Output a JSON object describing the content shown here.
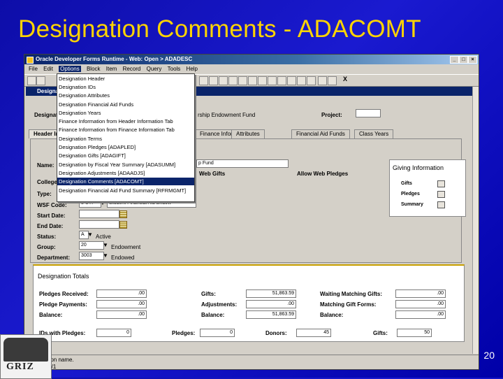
{
  "slide": {
    "title": "Designation Comments - ADACOMT",
    "page_number": "20",
    "logo_text": "GRIZ"
  },
  "window": {
    "title": "Oracle Developer Forms Runtime - Web: Open > ADADESC",
    "menubar": [
      "File",
      "Edit",
      "Options",
      "Block",
      "Item",
      "Record",
      "Query",
      "Tools",
      "Help"
    ],
    "active_menu": "Options",
    "toolbar_exit": "X"
  },
  "inner_window": {
    "title": "Designation"
  },
  "menu": {
    "items": [
      "Designation Header",
      "Designation IDs",
      "Designation Attributes",
      "Designation Financial Aid Funds",
      "Designation Years",
      "Finance Information from Header Information Tab",
      "Finance Information from Finance Information Tab",
      "Designation Terms",
      "Designation Pledges [ADAPLED]",
      "Designation Gifts [ADAGIFT]",
      "Designation by Fiscal Year Summary [ADASUMM]",
      "Designation Adjustments [ADAADJS]",
      "Designation Comments [ADACOMT]",
      "Designation Financial Aid Fund Summary [RFRMGMT]"
    ],
    "highlighted_index": 12
  },
  "header": {
    "designation_label": "Designation:",
    "designation_fragment": "rship Endowment Fund",
    "project_label": "Project:"
  },
  "tabs": [
    "Header Information",
    "Finance Information",
    "Attributes",
    "Financial Aid Funds",
    "Class Years"
  ],
  "form": {
    "name_label": "Name:",
    "name_value": "p Fund",
    "college_label": "College:",
    "type_label": "Type:",
    "wsf_label": "WSF Code:",
    "wsf_value": "8 UTI",
    "wsf_desc": "Student Financial Aid Endow",
    "start_label": "Start Date:",
    "end_label": "End Date:",
    "status_label": "Status:",
    "status_value": "A",
    "status_desc": "Active",
    "group_label": "Group:",
    "group_value": "20",
    "group_desc": "Endowment",
    "dept_label": "Department:",
    "dept_value": "3003",
    "dept_desc": "Endowed",
    "allow_web_gifts": "Web Gifts",
    "allow_web_pledges": "Allow Web Pledges"
  },
  "giving_information": {
    "title": "Giving Information",
    "items": [
      "Gifts",
      "Pledges",
      "Summary"
    ]
  },
  "totals": {
    "title": "Designation Totals",
    "left": [
      {
        "label": "Pledges Received:",
        "value": ".00"
      },
      {
        "label": "Pledge Payments:",
        "value": ".00"
      },
      {
        "label": "Balance:",
        "value": ".00"
      }
    ],
    "middle": [
      {
        "label": "Gifts:",
        "value": "51,863.59"
      },
      {
        "label": "Adjustments:",
        "value": ".00"
      },
      {
        "label": "Balance:",
        "value": "51,863.59"
      }
    ],
    "right": [
      {
        "label": "Waiting Matching Gifts:",
        "value": ".00"
      },
      {
        "label": "Matching Gift Forms:",
        "value": ".00"
      },
      {
        "label": "Balance:",
        "value": ".00"
      }
    ],
    "ids_label": "IDs with Pledges:",
    "ids_value": "0",
    "pledges_label": "Pledges:",
    "pledges_value": "0",
    "donors_label": "Donors:",
    "donors_value": "45",
    "gifts_label": "Gifts:",
    "gifts_value": "50"
  },
  "status": {
    "line1": "Designation name.",
    "line2": "Record: 1/1"
  }
}
